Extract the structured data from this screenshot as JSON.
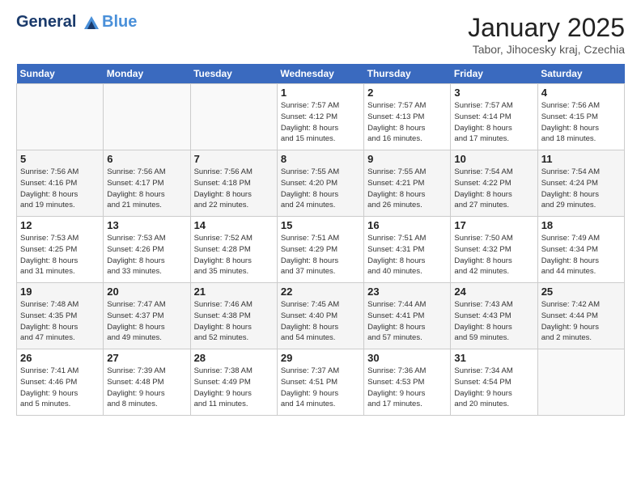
{
  "header": {
    "logo_line1": "General",
    "logo_line2": "Blue",
    "month_title": "January 2025",
    "location": "Tabor, Jihocesky kraj, Czechia"
  },
  "days_of_week": [
    "Sunday",
    "Monday",
    "Tuesday",
    "Wednesday",
    "Thursday",
    "Friday",
    "Saturday"
  ],
  "weeks": [
    [
      {
        "num": "",
        "detail": ""
      },
      {
        "num": "",
        "detail": ""
      },
      {
        "num": "",
        "detail": ""
      },
      {
        "num": "1",
        "detail": "Sunrise: 7:57 AM\nSunset: 4:12 PM\nDaylight: 8 hours\nand 15 minutes."
      },
      {
        "num": "2",
        "detail": "Sunrise: 7:57 AM\nSunset: 4:13 PM\nDaylight: 8 hours\nand 16 minutes."
      },
      {
        "num": "3",
        "detail": "Sunrise: 7:57 AM\nSunset: 4:14 PM\nDaylight: 8 hours\nand 17 minutes."
      },
      {
        "num": "4",
        "detail": "Sunrise: 7:56 AM\nSunset: 4:15 PM\nDaylight: 8 hours\nand 18 minutes."
      }
    ],
    [
      {
        "num": "5",
        "detail": "Sunrise: 7:56 AM\nSunset: 4:16 PM\nDaylight: 8 hours\nand 19 minutes."
      },
      {
        "num": "6",
        "detail": "Sunrise: 7:56 AM\nSunset: 4:17 PM\nDaylight: 8 hours\nand 21 minutes."
      },
      {
        "num": "7",
        "detail": "Sunrise: 7:56 AM\nSunset: 4:18 PM\nDaylight: 8 hours\nand 22 minutes."
      },
      {
        "num": "8",
        "detail": "Sunrise: 7:55 AM\nSunset: 4:20 PM\nDaylight: 8 hours\nand 24 minutes."
      },
      {
        "num": "9",
        "detail": "Sunrise: 7:55 AM\nSunset: 4:21 PM\nDaylight: 8 hours\nand 26 minutes."
      },
      {
        "num": "10",
        "detail": "Sunrise: 7:54 AM\nSunset: 4:22 PM\nDaylight: 8 hours\nand 27 minutes."
      },
      {
        "num": "11",
        "detail": "Sunrise: 7:54 AM\nSunset: 4:24 PM\nDaylight: 8 hours\nand 29 minutes."
      }
    ],
    [
      {
        "num": "12",
        "detail": "Sunrise: 7:53 AM\nSunset: 4:25 PM\nDaylight: 8 hours\nand 31 minutes."
      },
      {
        "num": "13",
        "detail": "Sunrise: 7:53 AM\nSunset: 4:26 PM\nDaylight: 8 hours\nand 33 minutes."
      },
      {
        "num": "14",
        "detail": "Sunrise: 7:52 AM\nSunset: 4:28 PM\nDaylight: 8 hours\nand 35 minutes."
      },
      {
        "num": "15",
        "detail": "Sunrise: 7:51 AM\nSunset: 4:29 PM\nDaylight: 8 hours\nand 37 minutes."
      },
      {
        "num": "16",
        "detail": "Sunrise: 7:51 AM\nSunset: 4:31 PM\nDaylight: 8 hours\nand 40 minutes."
      },
      {
        "num": "17",
        "detail": "Sunrise: 7:50 AM\nSunset: 4:32 PM\nDaylight: 8 hours\nand 42 minutes."
      },
      {
        "num": "18",
        "detail": "Sunrise: 7:49 AM\nSunset: 4:34 PM\nDaylight: 8 hours\nand 44 minutes."
      }
    ],
    [
      {
        "num": "19",
        "detail": "Sunrise: 7:48 AM\nSunset: 4:35 PM\nDaylight: 8 hours\nand 47 minutes."
      },
      {
        "num": "20",
        "detail": "Sunrise: 7:47 AM\nSunset: 4:37 PM\nDaylight: 8 hours\nand 49 minutes."
      },
      {
        "num": "21",
        "detail": "Sunrise: 7:46 AM\nSunset: 4:38 PM\nDaylight: 8 hours\nand 52 minutes."
      },
      {
        "num": "22",
        "detail": "Sunrise: 7:45 AM\nSunset: 4:40 PM\nDaylight: 8 hours\nand 54 minutes."
      },
      {
        "num": "23",
        "detail": "Sunrise: 7:44 AM\nSunset: 4:41 PM\nDaylight: 8 hours\nand 57 minutes."
      },
      {
        "num": "24",
        "detail": "Sunrise: 7:43 AM\nSunset: 4:43 PM\nDaylight: 8 hours\nand 59 minutes."
      },
      {
        "num": "25",
        "detail": "Sunrise: 7:42 AM\nSunset: 4:44 PM\nDaylight: 9 hours\nand 2 minutes."
      }
    ],
    [
      {
        "num": "26",
        "detail": "Sunrise: 7:41 AM\nSunset: 4:46 PM\nDaylight: 9 hours\nand 5 minutes."
      },
      {
        "num": "27",
        "detail": "Sunrise: 7:39 AM\nSunset: 4:48 PM\nDaylight: 9 hours\nand 8 minutes."
      },
      {
        "num": "28",
        "detail": "Sunrise: 7:38 AM\nSunset: 4:49 PM\nDaylight: 9 hours\nand 11 minutes."
      },
      {
        "num": "29",
        "detail": "Sunrise: 7:37 AM\nSunset: 4:51 PM\nDaylight: 9 hours\nand 14 minutes."
      },
      {
        "num": "30",
        "detail": "Sunrise: 7:36 AM\nSunset: 4:53 PM\nDaylight: 9 hours\nand 17 minutes."
      },
      {
        "num": "31",
        "detail": "Sunrise: 7:34 AM\nSunset: 4:54 PM\nDaylight: 9 hours\nand 20 minutes."
      },
      {
        "num": "",
        "detail": ""
      }
    ]
  ]
}
